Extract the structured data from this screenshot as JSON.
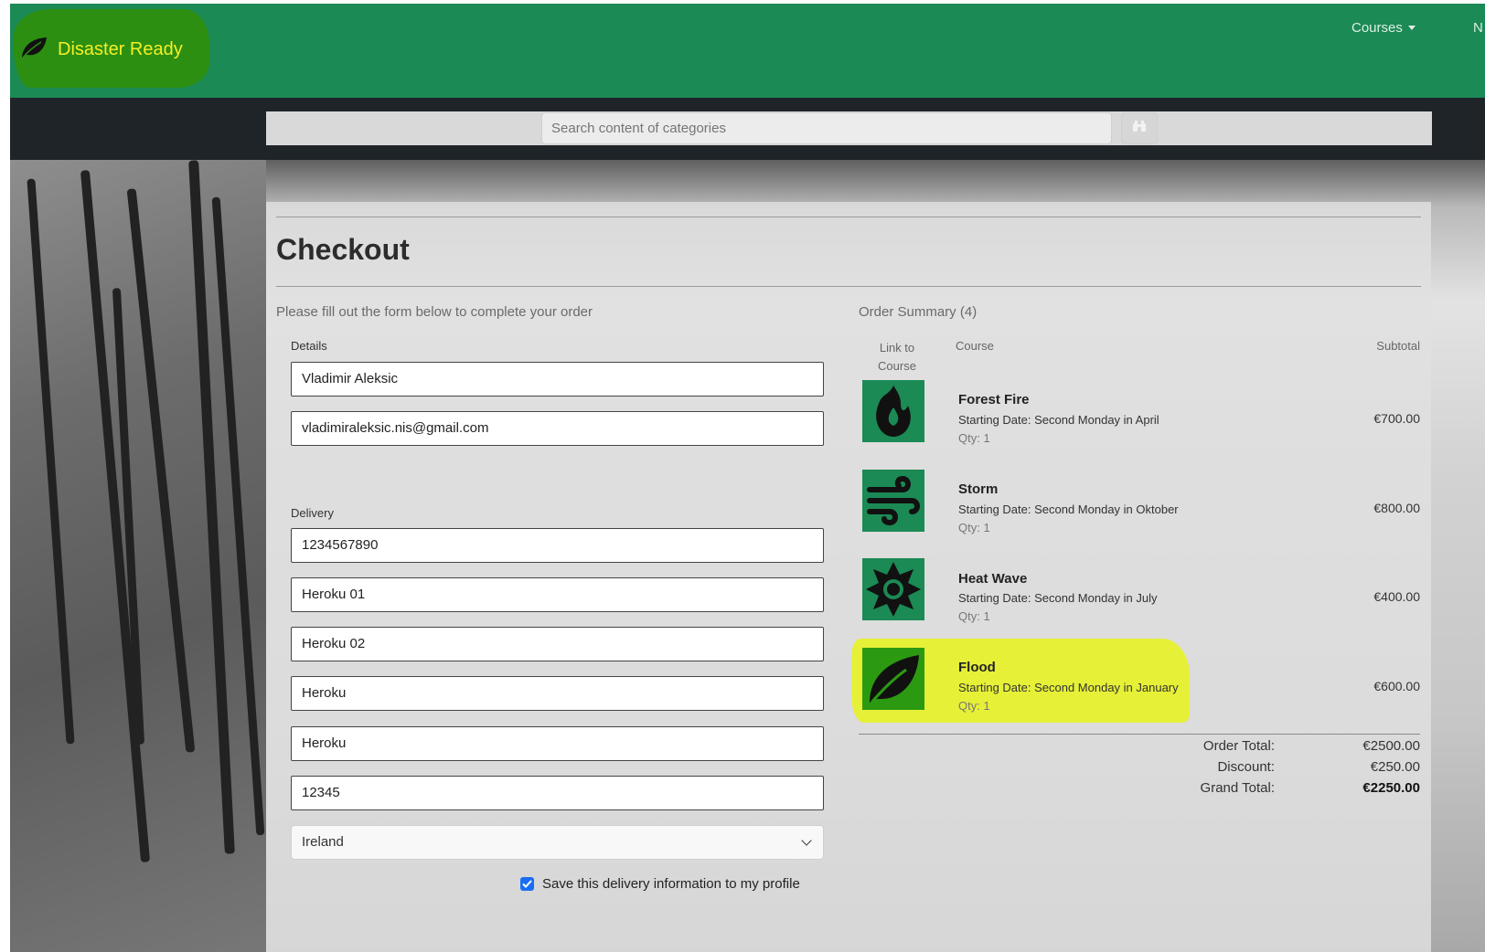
{
  "brand": {
    "name": "Disaster Ready",
    "logo_icon": "leaf-icon",
    "color": "#f4ef28"
  },
  "nav": {
    "courses_label": "Courses",
    "more_label": "N"
  },
  "search": {
    "placeholder": "Search content of categories",
    "button_icon": "binoculars-icon"
  },
  "checkout": {
    "title": "Checkout",
    "lead": "Please fill out the form below to complete your order",
    "details_label": "Details",
    "full_name": "Vladimir Aleksic",
    "email": "vladimiraleksic.nis@gmail.com",
    "delivery_label": "Delivery",
    "phone": "1234567890",
    "street1": "Heroku 01",
    "street2": "Heroku 02",
    "town": "Heroku",
    "county": "Heroku",
    "postcode": "12345",
    "country": "Ireland",
    "save_label": "Save this delivery information to my profile",
    "save_checked": true
  },
  "summary": {
    "title": "Order Summary (4)",
    "col_link": "Link to Course",
    "col_course": "Course",
    "col_subtotal": "Subtotal",
    "items": [
      {
        "name": "Forest Fire",
        "date": "Starting Date: Second Monday in April",
        "qty": "Qty: 1",
        "price": "€700.00",
        "icon": "flame-icon"
      },
      {
        "name": "Storm",
        "date": "Starting Date: Second Monday in Oktober",
        "qty": "Qty: 1",
        "price": "€800.00",
        "icon": "wind-icon"
      },
      {
        "name": "Heat Wave",
        "date": "Starting Date: Second Monday in July",
        "qty": "Qty: 1",
        "price": "€400.00",
        "icon": "sun-icon"
      },
      {
        "name": "Flood",
        "date": "Starting Date: Second Monday in January",
        "qty": "Qty: 1",
        "price": "€600.00",
        "icon": "leaf-icon"
      }
    ],
    "order_total_label": "Order Total:",
    "order_total": "€2500.00",
    "discount_label": "Discount:",
    "discount": "€250.00",
    "grand_total_label": "Grand Total:",
    "grand_total": "€2250.00"
  },
  "colors": {
    "header": "#1b8a55",
    "searchbar": "#1f2429",
    "highlight": "#e8f31a",
    "checkbox": "#1b6ef3"
  }
}
